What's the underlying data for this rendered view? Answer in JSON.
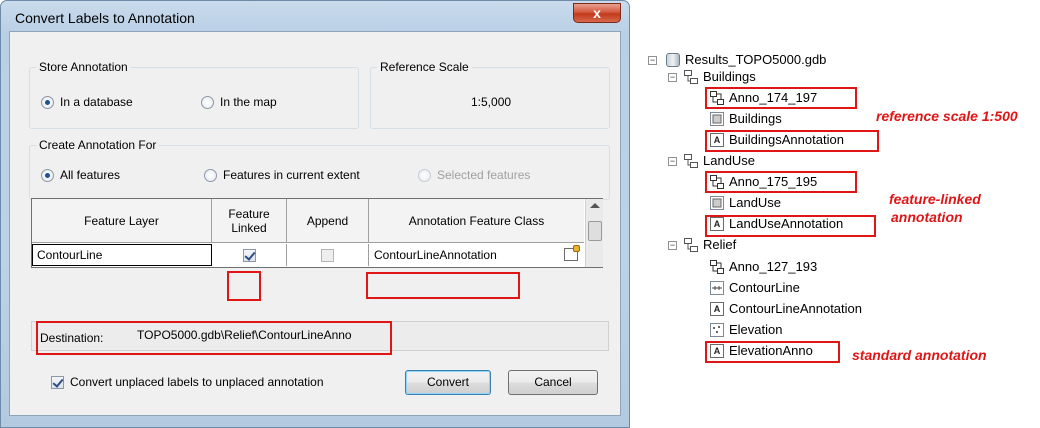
{
  "dialog": {
    "title": "Convert Labels to Annotation",
    "close_glyph": "x",
    "store": {
      "label": "Store Annotation",
      "options": [
        {
          "label": "In a database",
          "checked": true
        },
        {
          "label": "In the map",
          "checked": false
        }
      ]
    },
    "reference_scale": {
      "label": "Reference Scale",
      "value": "1:5,000"
    },
    "create_for": {
      "label": "Create Annotation For",
      "options": [
        {
          "label": "All features",
          "checked": true,
          "enabled": true
        },
        {
          "label": "Features in current extent",
          "checked": false,
          "enabled": true
        },
        {
          "label": "Selected features",
          "checked": false,
          "enabled": false
        }
      ]
    },
    "grid": {
      "headers": [
        "Feature Layer",
        "Feature Linked",
        "Append",
        "Annotation Feature Class"
      ],
      "row": {
        "layer": "ContourLine",
        "linked": true,
        "append": false,
        "anno_class": "ContourLineAnnotation"
      }
    },
    "destination": {
      "label": "Destination:",
      "value": "TOPO5000.gdb\\Relief\\ContourLineAnno"
    },
    "convert_unplaced": {
      "label": "Convert unplaced labels to unplaced annotation",
      "checked": true
    },
    "buttons": {
      "convert": "Convert",
      "cancel": "Cancel"
    }
  },
  "tree": {
    "root": "Results_TOPO5000.gdb",
    "datasets": [
      {
        "name": "Buildings",
        "children": [
          {
            "name": "Anno_174_197",
            "icon": "relationship-icon"
          },
          {
            "name": "Buildings",
            "icon": "polygon-fc-icon"
          },
          {
            "name": "BuildingsAnnotation",
            "icon": "annotation-icon"
          }
        ]
      },
      {
        "name": "LandUse",
        "children": [
          {
            "name": "Anno_175_195",
            "icon": "relationship-icon"
          },
          {
            "name": "LandUse",
            "icon": "polygon-fc-icon"
          },
          {
            "name": "LandUseAnnotation",
            "icon": "annotation-icon"
          }
        ]
      },
      {
        "name": "Relief",
        "children": [
          {
            "name": "Anno_127_193",
            "icon": "relationship-icon"
          },
          {
            "name": "ContourLine",
            "icon": "line-fc-icon"
          },
          {
            "name": "ContourLineAnnotation",
            "icon": "annotation-icon"
          },
          {
            "name": "Elevation",
            "icon": "point-fc-icon"
          },
          {
            "name": "ElevationAnno",
            "icon": "annotation-icon"
          }
        ]
      }
    ]
  },
  "annotations": {
    "reference_scale": "reference scale 1:500",
    "feature_linked_1": "feature-linked",
    "feature_linked_2": "annotation",
    "standard": "standard annotation"
  },
  "colors": {
    "highlight": "#e01616"
  }
}
